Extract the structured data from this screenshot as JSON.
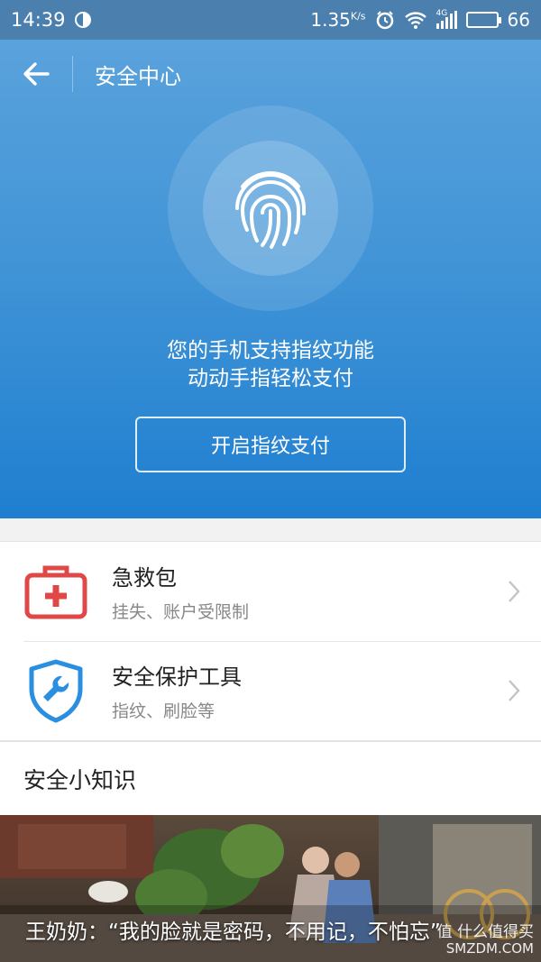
{
  "status_bar": {
    "time": "14:39",
    "speed": "1.35",
    "speed_unit": "K/s",
    "network": "4G",
    "battery": "66",
    "battery_level": 0.66
  },
  "header": {
    "title": "安全中心"
  },
  "hero": {
    "line1": "您的手机支持指纹功能",
    "line2": "动动手指轻松支付",
    "button_label": "开启指纹支付"
  },
  "menu": [
    {
      "title": "急救包",
      "subtitle": "挂失、账户受限制",
      "icon": "first-aid-kit-icon",
      "color": "#e04848"
    },
    {
      "title": "安全保护工具",
      "subtitle": "指纹、刷脸等",
      "icon": "shield-wrench-icon",
      "color": "#2a8fe0"
    }
  ],
  "tips": {
    "title": "安全小知识",
    "caption": "王奶奶：“我的脸就是密码，不用记，不怕忘”"
  },
  "watermark": {
    "line1": "值 什么值得买",
    "line2": "SMZDM.COM"
  }
}
